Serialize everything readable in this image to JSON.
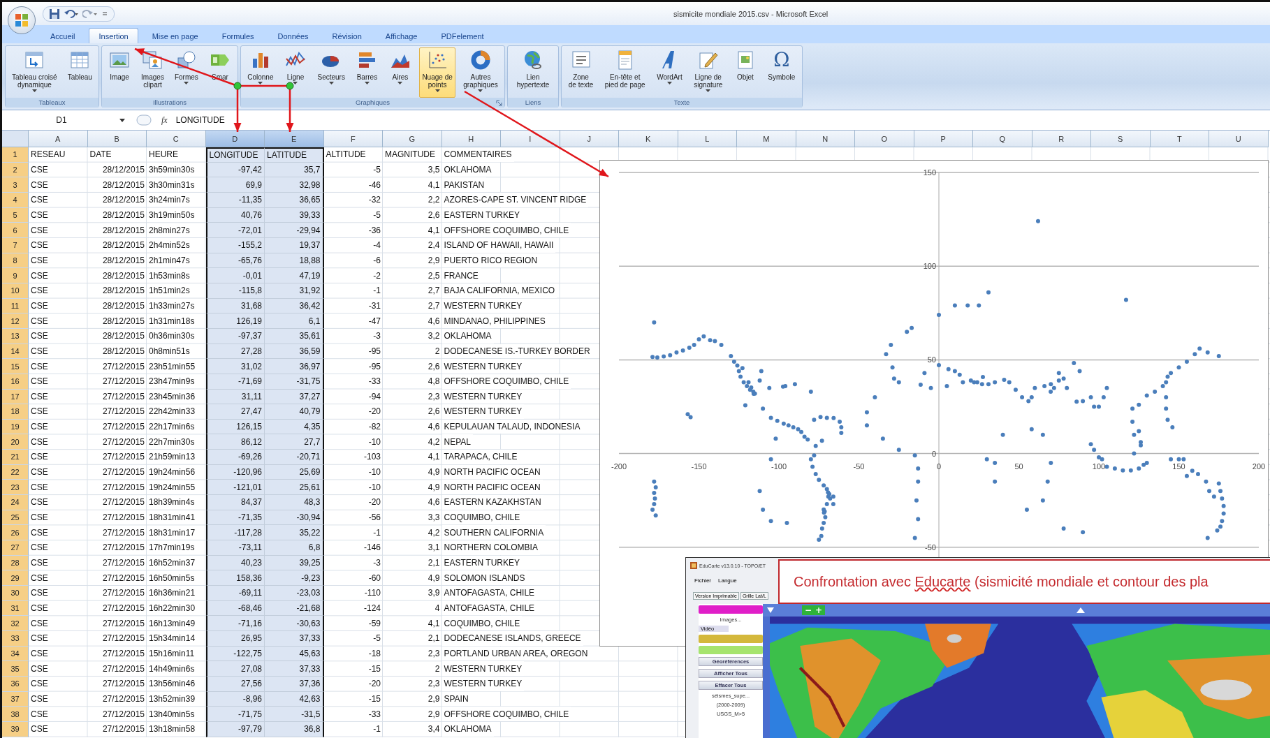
{
  "window": {
    "title": "sismicite mondiale 2015.csv - Microsoft Excel"
  },
  "tabs": [
    {
      "label": "Accueil",
      "selected": false
    },
    {
      "label": "Insertion",
      "selected": true
    },
    {
      "label": "Mise en page",
      "selected": false
    },
    {
      "label": "Formules",
      "selected": false
    },
    {
      "label": "Données",
      "selected": false
    },
    {
      "label": "Révision",
      "selected": false
    },
    {
      "label": "Affichage",
      "selected": false
    },
    {
      "label": "PDFelement",
      "selected": false
    }
  ],
  "ribbon": {
    "groups": [
      {
        "label": "Tableaux",
        "launcher": false,
        "buttons": [
          {
            "lines": [
              "Tableau croisé",
              "dynamique"
            ],
            "kind": "pivot",
            "dropdown": true,
            "selected": false
          },
          {
            "lines": [
              "Tableau"
            ],
            "kind": "table",
            "dropdown": false,
            "selected": false
          }
        ]
      },
      {
        "label": "Illustrations",
        "launcher": false,
        "buttons": [
          {
            "lines": [
              "Image"
            ],
            "dropdown": false,
            "selected": false
          },
          {
            "lines": [
              "Images",
              "clipart"
            ],
            "kind": "clipart",
            "dropdown": false,
            "selected": false
          },
          {
            "lines": [
              "Formes"
            ],
            "kind": "shapes",
            "dropdown": true,
            "selected": false
          },
          {
            "lines": [
              "Smar"
            ],
            "kind": "smartart",
            "dropdown": false,
            "selected": false
          }
        ]
      },
      {
        "label": "Graphiques",
        "launcher": true,
        "buttons": [
          {
            "lines": [
              "Colonne"
            ],
            "kind": "column",
            "dropdown": true,
            "selected": false
          },
          {
            "lines": [
              "Ligne"
            ],
            "kind": "line",
            "dropdown": true,
            "selected": false
          },
          {
            "lines": [
              "Secteurs"
            ],
            "kind": "pie",
            "dropdown": true,
            "selected": false
          },
          {
            "lines": [
              "Barres"
            ],
            "kind": "bar",
            "dropdown": true,
            "selected": false
          },
          {
            "lines": [
              "Aires"
            ],
            "kind": "area",
            "dropdown": true,
            "selected": false
          },
          {
            "lines": [
              "Nuage de",
              "points"
            ],
            "kind": "scatter",
            "dropdown": true,
            "selected": true
          },
          {
            "lines": [
              "Autres",
              "graphiques"
            ],
            "kind": "donut",
            "dropdown": true,
            "selected": false
          }
        ]
      },
      {
        "label": "Liens",
        "launcher": false,
        "buttons": [
          {
            "lines": [
              "Lien",
              "hypertexte"
            ],
            "kind": "hyperlink",
            "dropdown": false,
            "selected": false
          }
        ]
      },
      {
        "label": "Texte",
        "launcher": false,
        "buttons": [
          {
            "lines": [
              "Zone",
              "de texte"
            ],
            "kind": "textbox",
            "dropdown": false,
            "selected": false
          },
          {
            "lines": [
              "En-tête et",
              "pied de page"
            ],
            "kind": "header",
            "dropdown": false,
            "selected": false
          },
          {
            "lines": [
              "WordArt"
            ],
            "kind": "wordart",
            "dropdown": true,
            "selected": false
          },
          {
            "lines": [
              "Ligne de",
              "signature"
            ],
            "kind": "signature",
            "dropdown": true,
            "selected": false
          },
          {
            "lines": [
              "Objet"
            ],
            "kind": "object",
            "dropdown": false,
            "selected": false
          },
          {
            "lines": [
              "Symbole"
            ],
            "kind": "glyph",
            "glyph": "Ω",
            "dropdown": false,
            "selected": false
          }
        ]
      }
    ]
  },
  "formula_bar": {
    "name_box": "D1",
    "fx": "fx",
    "value": "LONGITUDE"
  },
  "table": {
    "columns": [
      {
        "letter": "A",
        "kind": "text",
        "selected": false
      },
      {
        "letter": "B",
        "kind": "number",
        "selected": false
      },
      {
        "letter": "C",
        "kind": "text",
        "selected": false
      },
      {
        "letter": "D",
        "kind": "number",
        "selected": true
      },
      {
        "letter": "E",
        "kind": "number",
        "selected": true
      },
      {
        "letter": "F",
        "kind": "number",
        "selected": false
      },
      {
        "letter": "G",
        "kind": "number",
        "selected": false
      },
      {
        "letter": "H",
        "kind": "text",
        "selected": false
      },
      {
        "letter": "I",
        "selected": false
      },
      {
        "letter": "J",
        "selected": false
      },
      {
        "letter": "K",
        "selected": false
      },
      {
        "letter": "L",
        "selected": false
      },
      {
        "letter": "M",
        "selected": false
      },
      {
        "letter": "N",
        "selected": false
      },
      {
        "letter": "O",
        "selected": false
      },
      {
        "letter": "P",
        "selected": false
      },
      {
        "letter": "Q",
        "selected": false
      },
      {
        "letter": "R",
        "selected": false
      },
      {
        "letter": "S",
        "selected": false
      },
      {
        "letter": "T",
        "selected": false
      },
      {
        "letter": "U",
        "selected": false
      }
    ],
    "rows": [
      {
        "number": "1",
        "selected": true,
        "cells": [
          "RESEAU",
          "DATE",
          "HEURE",
          "LONGITUDE",
          "LATITUDE",
          "ALTITUDE",
          "MAGNITUDE",
          "COMMENTAIRES"
        ]
      },
      {
        "number": "2",
        "selected": true,
        "cells": [
          "CSE",
          "28/12/2015",
          "3h59min30s",
          "-97,42",
          "35,7",
          "-5",
          "3,5",
          "OKLAHOMA"
        ]
      },
      {
        "number": "3",
        "selected": true,
        "cells": [
          "CSE",
          "28/12/2015",
          "3h30min31s",
          "69,9",
          "32,98",
          "-46",
          "4,1",
          "PAKISTAN"
        ]
      },
      {
        "number": "4",
        "selected": true,
        "cells": [
          "CSE",
          "28/12/2015",
          "3h24min7s",
          "-11,35",
          "36,65",
          "-32",
          "2,2",
          "AZORES-CAPE ST. VINCENT RIDGE"
        ]
      },
      {
        "number": "5",
        "selected": true,
        "cells": [
          "CSE",
          "28/12/2015",
          "3h19min50s",
          "40,76",
          "39,33",
          "-5",
          "2,6",
          "EASTERN TURKEY"
        ]
      },
      {
        "number": "6",
        "selected": true,
        "cells": [
          "CSE",
          "28/12/2015",
          "2h8min27s",
          "-72,01",
          "-29,94",
          "-36",
          "4,1",
          "OFFSHORE COQUIMBO, CHILE"
        ]
      },
      {
        "number": "7",
        "selected": true,
        "cells": [
          "CSE",
          "28/12/2015",
          "2h4min52s",
          "-155,2",
          "19,37",
          "-4",
          "2,4",
          "ISLAND OF HAWAII, HAWAII"
        ]
      },
      {
        "number": "8",
        "selected": true,
        "cells": [
          "CSE",
          "28/12/2015",
          "2h1min47s",
          "-65,76",
          "18,88",
          "-6",
          "2,9",
          "PUERTO RICO REGION"
        ]
      },
      {
        "number": "9",
        "selected": true,
        "cells": [
          "CSE",
          "28/12/2015",
          "1h53min8s",
          "-0,01",
          "47,19",
          "-2",
          "2,5",
          "FRANCE"
        ]
      },
      {
        "number": "10",
        "selected": true,
        "cells": [
          "CSE",
          "28/12/2015",
          "1h51min2s",
          "-115,8",
          "31,92",
          "-1",
          "2,7",
          "BAJA CALIFORNIA, MEXICO"
        ]
      },
      {
        "number": "11",
        "selected": true,
        "cells": [
          "CSE",
          "28/12/2015",
          "1h33min27s",
          "31,68",
          "36,42",
          "-31",
          "2,7",
          "WESTERN TURKEY"
        ]
      },
      {
        "number": "12",
        "selected": true,
        "cells": [
          "CSE",
          "28/12/2015",
          "1h31min18s",
          "126,19",
          "6,1",
          "-47",
          "4,6",
          "MINDANAO, PHILIPPINES"
        ]
      },
      {
        "number": "13",
        "selected": true,
        "cells": [
          "CSE",
          "28/12/2015",
          "0h36min30s",
          "-97,37",
          "35,61",
          "-3",
          "3,2",
          "OKLAHOMA"
        ]
      },
      {
        "number": "14",
        "selected": true,
        "cells": [
          "CSE",
          "28/12/2015",
          "0h8min51s",
          "27,28",
          "36,59",
          "-95",
          "2",
          "DODECANESE IS.-TURKEY BORDER"
        ]
      },
      {
        "number": "15",
        "selected": true,
        "cells": [
          "CSE",
          "27/12/2015",
          "23h51min55",
          "31,02",
          "36,97",
          "-95",
          "2,6",
          "WESTERN TURKEY"
        ]
      },
      {
        "number": "16",
        "selected": true,
        "cells": [
          "CSE",
          "27/12/2015",
          "23h47min9s",
          "-71,69",
          "-31,75",
          "-33",
          "4,8",
          "OFFSHORE COQUIMBO, CHILE"
        ]
      },
      {
        "number": "17",
        "selected": true,
        "cells": [
          "CSE",
          "27/12/2015",
          "23h45min36",
          "31,11",
          "37,27",
          "-94",
          "2,3",
          "WESTERN TURKEY"
        ]
      },
      {
        "number": "18",
        "selected": true,
        "cells": [
          "CSE",
          "27/12/2015",
          "22h42min33",
          "27,47",
          "40,79",
          "-20",
          "2,6",
          "WESTERN TURKEY"
        ]
      },
      {
        "number": "19",
        "selected": true,
        "cells": [
          "CSE",
          "27/12/2015",
          "22h17min6s",
          "126,15",
          "4,35",
          "-82",
          "4,6",
          "KEPULAUAN TALAUD, INDONESIA"
        ]
      },
      {
        "number": "20",
        "selected": true,
        "cells": [
          "CSE",
          "27/12/2015",
          "22h7min30s",
          "86,12",
          "27,7",
          "-10",
          "4,2",
          "NEPAL"
        ]
      },
      {
        "number": "21",
        "selected": true,
        "cells": [
          "CSE",
          "27/12/2015",
          "21h59min13",
          "-69,26",
          "-20,71",
          "-103",
          "4,1",
          "TARAPACA, CHILE"
        ]
      },
      {
        "number": "22",
        "selected": true,
        "cells": [
          "CSE",
          "27/12/2015",
          "19h24min56",
          "-120,96",
          "25,69",
          "-10",
          "4,9",
          "NORTH PACIFIC OCEAN"
        ]
      },
      {
        "number": "23",
        "selected": true,
        "cells": [
          "CSE",
          "27/12/2015",
          "19h24min55",
          "-121,01",
          "25,61",
          "-10",
          "4,9",
          "NORTH PACIFIC OCEAN"
        ]
      },
      {
        "number": "24",
        "selected": true,
        "cells": [
          "CSE",
          "27/12/2015",
          "18h39min4s",
          "84,37",
          "48,3",
          "-20",
          "4,6",
          "EASTERN KAZAKHSTAN"
        ]
      },
      {
        "number": "25",
        "selected": true,
        "cells": [
          "CSE",
          "27/12/2015",
          "18h31min41",
          "-71,35",
          "-30,94",
          "-56",
          "3,3",
          "COQUIMBO, CHILE"
        ]
      },
      {
        "number": "26",
        "selected": true,
        "cells": [
          "CSE",
          "27/12/2015",
          "18h31min17",
          "-117,28",
          "35,22",
          "-1",
          "4,2",
          "SOUTHERN CALIFORNIA"
        ]
      },
      {
        "number": "27",
        "selected": true,
        "cells": [
          "CSE",
          "27/12/2015",
          "17h7min19s",
          "-73,11",
          "6,8",
          "-146",
          "3,1",
          "NORTHERN COLOMBIA"
        ]
      },
      {
        "number": "28",
        "selected": true,
        "cells": [
          "CSE",
          "27/12/2015",
          "16h52min37",
          "40,23",
          "39,25",
          "-3",
          "2,1",
          "EASTERN TURKEY"
        ]
      },
      {
        "number": "29",
        "selected": true,
        "cells": [
          "CSE",
          "27/12/2015",
          "16h50min5s",
          "158,36",
          "-9,23",
          "-60",
          "4,9",
          "SOLOMON ISLANDS"
        ]
      },
      {
        "number": "30",
        "selected": true,
        "cells": [
          "CSE",
          "27/12/2015",
          "16h36min21",
          "-69,11",
          "-23,03",
          "-110",
          "3,9",
          "ANTOFAGASTA, CHILE"
        ]
      },
      {
        "number": "31",
        "selected": true,
        "cells": [
          "CSE",
          "27/12/2015",
          "16h22min30",
          "-68,46",
          "-21,68",
          "-124",
          "4",
          "ANTOFAGASTA, CHILE"
        ]
      },
      {
        "number": "32",
        "selected": true,
        "cells": [
          "CSE",
          "27/12/2015",
          "16h13min49",
          "-71,16",
          "-30,63",
          "-59",
          "4,1",
          "COQUIMBO, CHILE"
        ]
      },
      {
        "number": "33",
        "selected": true,
        "cells": [
          "CSE",
          "27/12/2015",
          "15h34min14",
          "26,95",
          "37,33",
          "-5",
          "2,1",
          "DODECANESE ISLANDS, GREECE"
        ]
      },
      {
        "number": "34",
        "selected": true,
        "cells": [
          "CSE",
          "27/12/2015",
          "15h16min11",
          "-122,75",
          "45,63",
          "-18",
          "2,3",
          "PORTLAND URBAN AREA, OREGON"
        ]
      },
      {
        "number": "35",
        "selected": true,
        "cells": [
          "CSE",
          "27/12/2015",
          "14h49min6s",
          "27,08",
          "37,33",
          "-15",
          "2",
          "WESTERN TURKEY"
        ]
      },
      {
        "number": "36",
        "selected": true,
        "cells": [
          "CSE",
          "27/12/2015",
          "13h56min46",
          "27,56",
          "37,36",
          "-20",
          "2,3",
          "WESTERN TURKEY"
        ]
      },
      {
        "number": "37",
        "selected": true,
        "cells": [
          "CSE",
          "27/12/2015",
          "13h52min39",
          "-8,96",
          "42,63",
          "-15",
          "2,9",
          "SPAIN"
        ]
      },
      {
        "number": "38",
        "selected": true,
        "cells": [
          "CSE",
          "27/12/2015",
          "13h40min5s",
          "-71,75",
          "-31,5",
          "-33",
          "2,9",
          "OFFSHORE COQUIMBO, CHILE"
        ]
      },
      {
        "number": "39",
        "selected": true,
        "cells": [
          "CSE",
          "27/12/2015",
          "13h18min58",
          "-97,79",
          "36,8",
          "-1",
          "3,4",
          "OKLAHOMA"
        ]
      }
    ]
  },
  "chart": {
    "chart_data": {
      "type": "scatter",
      "grid": true,
      "xlim": [
        -200,
        200
      ],
      "ylim": [
        -100,
        150
      ],
      "xticks": [
        -200,
        -150,
        -100,
        -50,
        0,
        50,
        100,
        150,
        200
      ],
      "yticks": [
        -50,
        0,
        50,
        100,
        150
      ],
      "x": [
        -179,
        -176,
        -172,
        -168,
        -164,
        -160,
        -156,
        -153,
        -150,
        -147,
        -143,
        -140,
        -136,
        -178,
        -130,
        -128,
        -126,
        -125,
        -124,
        -122,
        -120,
        -118,
        -116,
        -115,
        -119,
        -111,
        -112,
        -106,
        -97.4,
        -96,
        -90,
        -80,
        -117.3,
        -115.8,
        -121,
        -122.8,
        -155.2,
        -157,
        -178,
        -177,
        -178,
        -177.5,
        -178,
        -179,
        -177,
        -110,
        -105,
        -101,
        -97,
        -94,
        -91,
        -88,
        -86,
        -84,
        -82,
        -78,
        -74,
        -70,
        -65.8,
        -62,
        -61,
        -61,
        -77,
        -73.1,
        -78,
        -80,
        -79,
        -77,
        -75,
        -72,
        -70,
        -69.3,
        -68.5,
        -69.1,
        -68,
        -70,
        -72,
        -71.4,
        -71.8,
        -71,
        -72,
        -73,
        -73.5,
        -75,
        -66,
        -66,
        -112,
        -110,
        -105,
        -95,
        -105,
        -102,
        -20,
        -17,
        -30,
        -33,
        -29,
        -28,
        -40,
        -45,
        -45,
        -35,
        -25,
        -15,
        -13,
        -13,
        -14,
        -13,
        -15,
        10,
        18,
        25,
        0,
        -9,
        -11.4,
        0,
        6,
        10,
        13,
        15,
        20,
        22,
        24,
        27,
        27.5,
        31,
        35,
        40.8,
        44,
        48,
        52,
        56,
        58,
        60,
        5,
        -5,
        -25,
        66,
        70,
        69.9,
        72,
        75,
        78,
        80,
        84.4,
        86.1,
        90,
        95,
        97,
        100,
        103,
        105,
        88,
        75,
        35,
        30,
        40,
        35,
        55,
        65,
        70,
        68,
        78,
        90,
        65,
        58,
        95,
        97,
        100,
        102,
        105,
        110,
        115,
        120,
        125,
        128,
        130,
        126.2,
        126.2,
        122,
        122,
        125,
        121,
        121,
        125,
        130,
        135,
        140,
        142,
        143,
        145,
        150,
        155,
        160,
        163,
        168,
        175,
        142,
        142,
        143,
        146,
        145,
        150,
        153,
        155,
        158.4,
        162,
        167,
        169,
        172,
        175,
        176,
        177,
        178,
        178,
        177,
        176,
        174,
        168,
        62,
        31,
        117
      ],
      "series": [
        {
          "color": "#4a7ebb",
          "values": [
            51.5,
            51.3,
            51.8,
            52.5,
            54,
            55,
            56.5,
            58,
            61,
            62.5,
            60.5,
            60,
            58,
            70,
            52,
            49,
            47,
            44,
            41,
            38,
            36,
            34,
            33,
            32,
            38,
            44,
            39,
            35,
            35.7,
            36,
            37,
            33,
            35.2,
            31.9,
            25.7,
            45.6,
            19.4,
            21,
            -15,
            -18,
            -21,
            -24,
            -27,
            -30,
            -33,
            24,
            19,
            17.5,
            16,
            15,
            14,
            13,
            11.5,
            9,
            7.5,
            18,
            19.5,
            19,
            18.9,
            17,
            14,
            11,
            4,
            6.8,
            -1,
            -3,
            -7,
            -11,
            -14,
            -17,
            -19,
            -20.7,
            -21.7,
            -23,
            -24,
            -27,
            -29.9,
            -30.9,
            -31.5,
            -34,
            -37,
            -40,
            -44,
            -46,
            -27,
            -23,
            -20,
            -30,
            -36,
            -37,
            -3,
            8,
            65,
            67,
            58,
            53,
            46,
            40,
            30,
            22,
            15,
            8,
            2,
            -1,
            -8,
            -15,
            -25,
            -35,
            -45,
            79,
            79,
            79,
            74,
            43,
            36.7,
            47.2,
            45,
            44,
            42,
            38,
            39,
            38,
            38,
            37,
            40.8,
            37,
            38,
            39.3,
            38,
            34,
            30,
            28,
            30,
            35,
            36,
            35,
            38,
            36,
            37,
            33,
            35,
            39,
            40,
            35,
            48.3,
            27.7,
            28,
            30,
            25,
            25,
            30,
            35,
            44,
            43,
            -5,
            -3,
            10,
            -15,
            -30,
            -25,
            -5,
            -15,
            -40,
            -42,
            10,
            13,
            5,
            2,
            -2,
            -3,
            -7,
            -8,
            -9,
            -9,
            -8,
            -6,
            -5,
            4.4,
            6.1,
            0,
            10,
            12,
            17,
            24,
            26,
            31,
            33,
            36,
            38,
            41,
            43,
            46,
            49,
            53,
            56,
            54,
            52,
            30,
            24,
            18,
            14,
            -3,
            -3,
            -3,
            -12,
            -9.2,
            -11,
            -15,
            -20,
            -23,
            -16,
            -20,
            -24,
            -28,
            -32,
            -36,
            -39,
            -41,
            -45,
            124,
            86,
            82
          ]
        }
      ]
    }
  },
  "educarte": {
    "title": "EduCarte v13.0.10 - TOPO/ET",
    "menu": [
      "Fichier",
      "Langue"
    ],
    "toolbar": [
      "Version Imprimable",
      "Grille Lat/L"
    ],
    "sidebar": [
      {
        "kind": "swatch",
        "color": "#e01ec8"
      },
      {
        "kind": "link",
        "label": "Images..."
      },
      {
        "kind": "tab",
        "label": "Vidéo"
      },
      {
        "kind": "swatch",
        "color": "#d4b83c"
      },
      {
        "kind": "swatch",
        "color": "#a6e46e"
      },
      {
        "kind": "button",
        "label": "Géoréférences"
      },
      {
        "kind": "button",
        "label": "Afficher Tous"
      },
      {
        "kind": "button",
        "label": "Effacer Tous"
      },
      {
        "kind": "text",
        "label": "séismes_supe..."
      },
      {
        "kind": "text",
        "label": "(2000-2009)"
      },
      {
        "kind": "text",
        "label": "USGS_M>5"
      }
    ],
    "zoom": [
      "−",
      "+"
    ],
    "callout": [
      {
        "text": "Confrontation avec ",
        "flagged": false
      },
      {
        "text": "Educarte",
        "flagged": true
      },
      {
        "text": " (sismicité mondiale et contour des pla",
        "flagged": false
      }
    ]
  }
}
